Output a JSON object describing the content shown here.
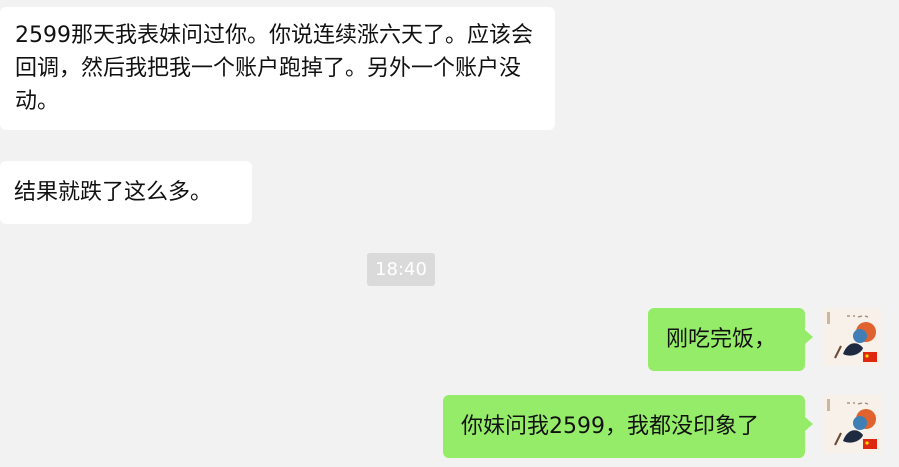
{
  "chat": {
    "messages": [
      {
        "side": "incoming",
        "text": "2599那天我表妹问过你。你说连续涨六天了。应该会回调，然后我把我一个账户跑掉了。另外一个账户没动。"
      },
      {
        "side": "incoming",
        "text": "结果就跌了这么多。"
      },
      {
        "side": "outgoing",
        "text": "刚吃完饭，"
      },
      {
        "side": "outgoing",
        "text": "你妹问我2599，我都没印象了"
      }
    ],
    "timestamp": "18:40"
  },
  "colors": {
    "background": "#f2f2f2",
    "incoming_bubble": "#ffffff",
    "outgoing_bubble": "#95ec69",
    "timestamp_bg": "#dadada"
  },
  "icons": {
    "avatar": "painting-avatar-with-flag-icon"
  }
}
